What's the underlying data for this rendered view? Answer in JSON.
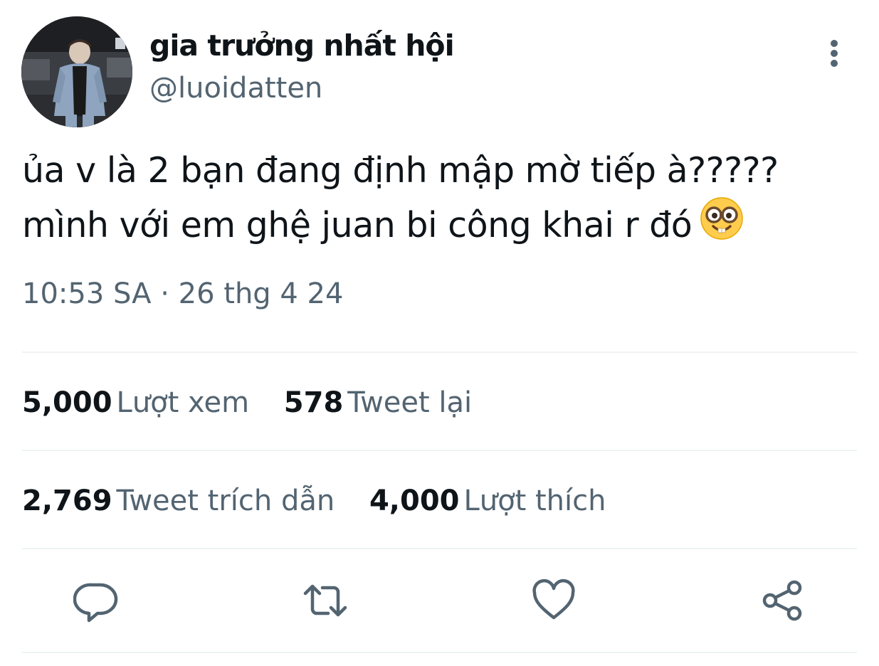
{
  "author": {
    "display_name": "gia trưởng nhất hội",
    "handle": "@luoidatten",
    "avatar": "avatar-photo"
  },
  "header": {
    "more_icon": "more-vertical-icon"
  },
  "tweet": {
    "line1": "ủa v là 2 bạn đang định mập mờ tiếp à?????",
    "line2": "mình với em ghệ juan bi công khai r đó",
    "emoji": "nerd-face-emoji"
  },
  "meta": {
    "time": "10:53 SA",
    "separator": "·",
    "date": "26 thg 4 24"
  },
  "stats": {
    "views": {
      "count": "5,000",
      "label": "Lượt xem"
    },
    "retweets": {
      "count": "578",
      "label": "Tweet lại"
    },
    "quotes": {
      "count": "2,769",
      "label": "Tweet trích dẫn"
    },
    "likes": {
      "count": "4,000",
      "label": "Lượt thích"
    }
  },
  "actions": {
    "reply_icon": "reply-icon",
    "retweet_icon": "retweet-icon",
    "like_icon": "heart-icon",
    "share_icon": "share-icon"
  },
  "colors": {
    "text_primary": "#0f1419",
    "text_secondary": "#536471",
    "divider": "#eff3f4"
  }
}
